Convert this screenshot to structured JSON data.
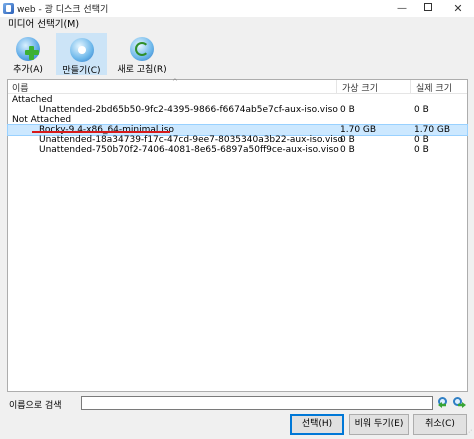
{
  "window": {
    "title": "web - 광 디스크 선택기",
    "minimize_glyph": "—",
    "close_glyph": "✕"
  },
  "dialog": {
    "title": "미디어 선택기(M)"
  },
  "toolbar": {
    "add_label": "추가(A)",
    "create_label": "만들기(C)",
    "refresh_label": "새로 고침(R)"
  },
  "table": {
    "columns": [
      "이름",
      "가상 크기",
      "실제 크기"
    ],
    "sort_arrow": "^",
    "groups": [
      {
        "label": "Attached",
        "rows": [
          {
            "name": "Unattended-2bd65b50-9fc2-4395-9866-f6674ab5e7cf-aux-iso.viso",
            "virtual_size": "0 B",
            "actual_size": "0 B"
          }
        ]
      },
      {
        "label": "Not Attached",
        "rows": [
          {
            "name": "Rocky-9.4-x86_64-minimal.iso",
            "virtual_size": "1.70 GB",
            "actual_size": "1.70 GB",
            "selected": true
          },
          {
            "name": "Unattended-18a34739-f17c-47cd-9ee7-8035340a3b22-aux-iso.viso",
            "virtual_size": "0 B",
            "actual_size": "0 B"
          },
          {
            "name": "Unattended-750b70f2-7406-4081-8e65-6897a50ff9ce-aux-iso.viso",
            "virtual_size": "0 B",
            "actual_size": "0 B"
          }
        ]
      }
    ]
  },
  "search": {
    "label": "이름으로 검색",
    "value": "",
    "placeholder": ""
  },
  "buttons": {
    "choose_label": "선택(H)",
    "leave_empty_label": "비워 두기(E)",
    "cancel_label": "취소(C)"
  },
  "colors": {
    "selection": "#cce8ff",
    "accent": "#0078d7",
    "annotation_underline": "#d81a1a"
  }
}
